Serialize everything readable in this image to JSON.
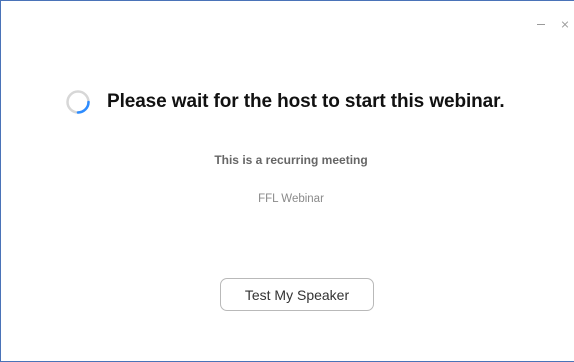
{
  "window": {
    "minimize_label": "—",
    "close_label": "×"
  },
  "main": {
    "heading": "Please wait for the host to start this webinar.",
    "subtitle": "This is a recurring meeting",
    "meeting_name": "FFL Webinar",
    "test_speaker_label": "Test My Speaker"
  },
  "icons": {
    "spinner": "spinner-icon",
    "minimize": "minimize-icon",
    "close": "close-icon"
  },
  "colors": {
    "spinner_arc": "#2d8cff",
    "spinner_track": "#d7d7d7",
    "window_border": "#4a73b8"
  }
}
